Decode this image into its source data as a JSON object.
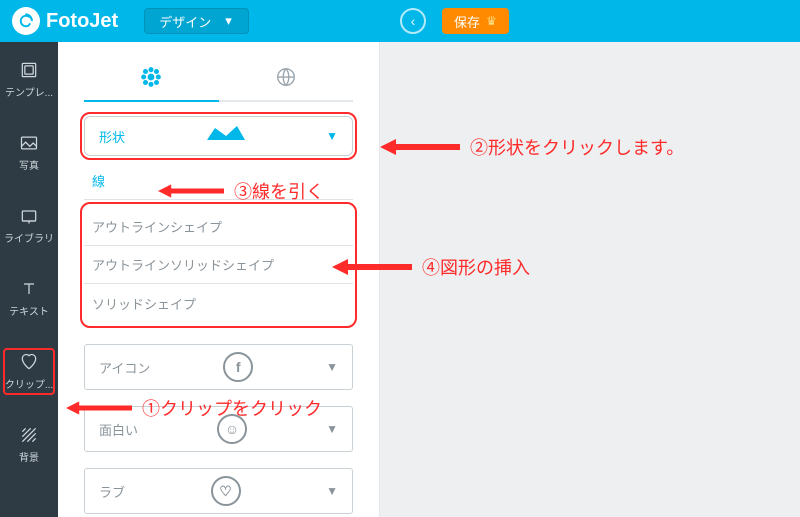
{
  "brand": {
    "name": "FotoJet"
  },
  "header": {
    "design_label": "デザイン",
    "save_label": "保存"
  },
  "leftnav": {
    "template": "テンプレ...",
    "photo": "写真",
    "library": "ライブラリ",
    "text": "テキスト",
    "clip": "クリップ...",
    "bg": "背景"
  },
  "shapes": {
    "dropdown_label": "形状",
    "options": {
      "line": "線",
      "outline": "アウトラインシェイプ",
      "outline_solid": "アウトラインソリッドシェイプ",
      "solid": "ソリッドシェイプ"
    }
  },
  "categories": {
    "icon": "アイコン",
    "funny": "面白い",
    "love": "ラブ"
  },
  "annotations": {
    "a1": "①クリップをクリック",
    "a2": "②形状をクリックします。",
    "a3": "③線を引く",
    "a4": "④図形の挿入"
  }
}
